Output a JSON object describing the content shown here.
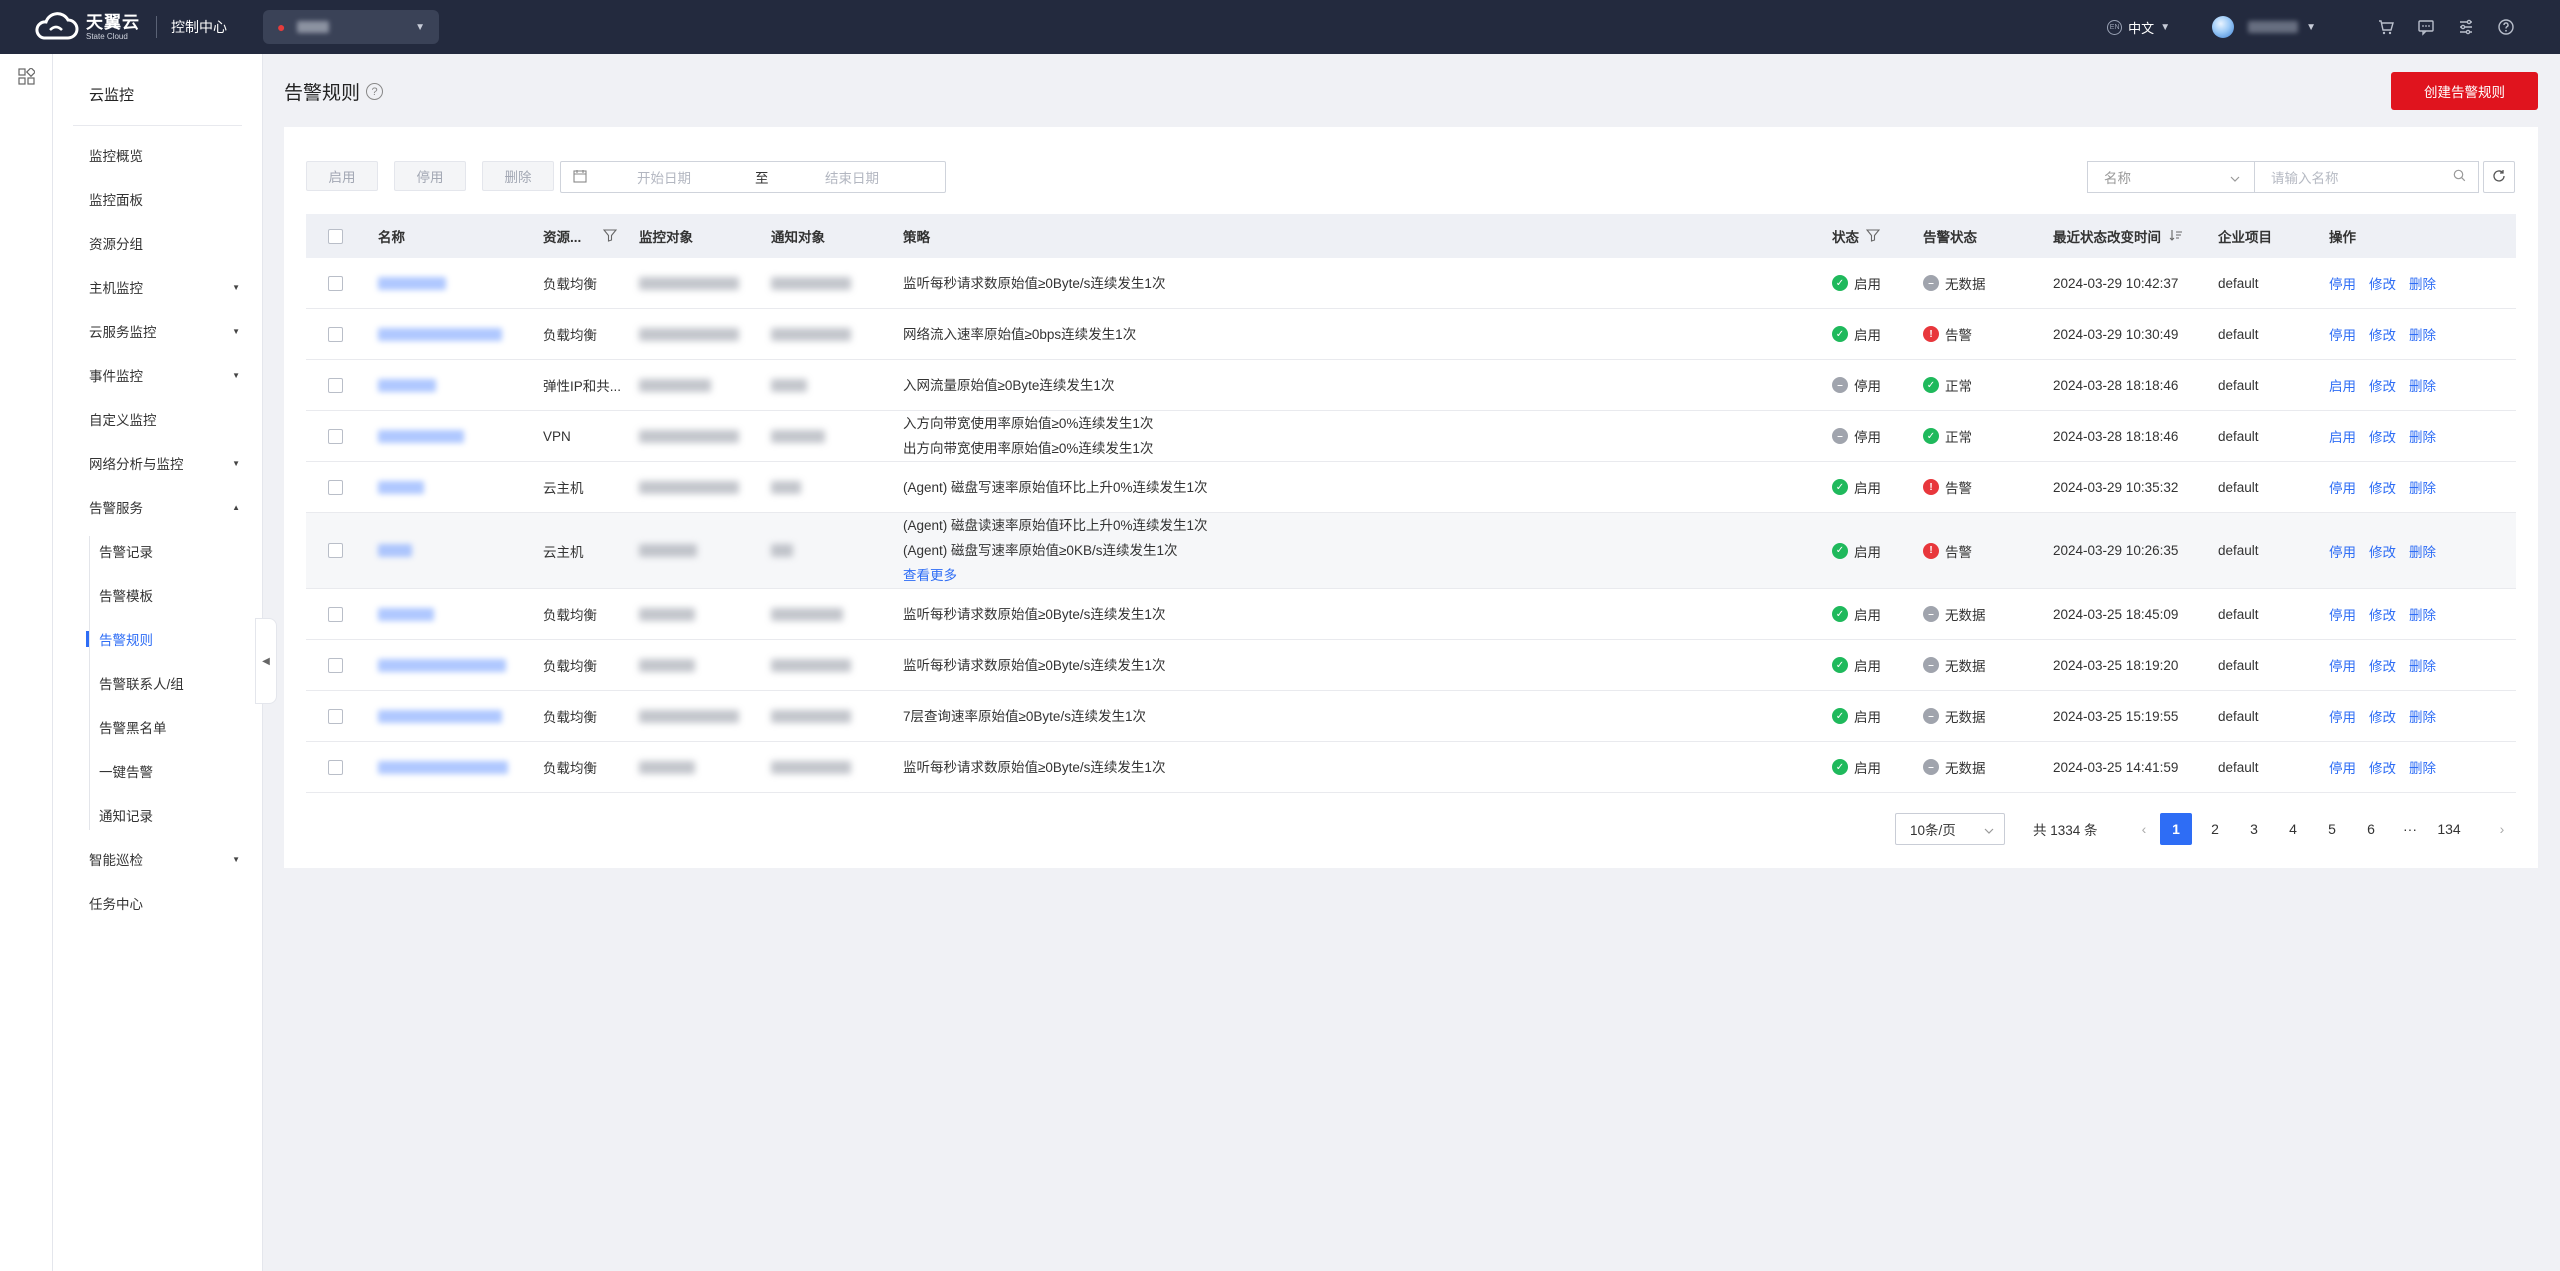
{
  "topbar": {
    "logo_cn": "天翼云",
    "logo_en": "State Cloud",
    "console": "控制中心",
    "lang": "中文",
    "lang_icon": "globe-icon",
    "icons": [
      "cart-icon",
      "message-icon",
      "settings-icon",
      "help-icon"
    ]
  },
  "sidebar": {
    "title": "云监控",
    "items": [
      {
        "label": "监控概览",
        "expandable": false
      },
      {
        "label": "监控面板",
        "expandable": false
      },
      {
        "label": "资源分组",
        "expandable": false
      },
      {
        "label": "主机监控",
        "expandable": true
      },
      {
        "label": "云服务监控",
        "expandable": true
      },
      {
        "label": "事件监控",
        "expandable": true
      },
      {
        "label": "自定义监控",
        "expandable": false
      },
      {
        "label": "网络分析与监控",
        "expandable": true
      },
      {
        "label": "告警服务",
        "expandable": true,
        "expanded": true
      },
      {
        "label": "告警记录",
        "sub": true
      },
      {
        "label": "告警模板",
        "sub": true
      },
      {
        "label": "告警规则",
        "sub": true,
        "active": true
      },
      {
        "label": "告警联系人/组",
        "sub": true
      },
      {
        "label": "告警黑名单",
        "sub": true
      },
      {
        "label": "一键告警",
        "sub": true
      },
      {
        "label": "通知记录",
        "sub": true
      },
      {
        "label": "智能巡检",
        "expandable": true
      },
      {
        "label": "任务中心",
        "expandable": false
      }
    ]
  },
  "page": {
    "title": "告警规则",
    "create_button": "创建告警规则"
  },
  "toolbar": {
    "enable": "启用",
    "disable": "停用",
    "delete": "删除",
    "start_placeholder": "开始日期",
    "to": "至",
    "end_placeholder": "结束日期",
    "filter_select": "名称",
    "search_placeholder": "请输入名称"
  },
  "table": {
    "columns": {
      "name": "名称",
      "resource": "资源...",
      "target": "监控对象",
      "notify": "通知对象",
      "policy": "策略",
      "status": "状态",
      "alarm_status": "告警状态",
      "last_change": "最近状态改变时间",
      "project": "企业项目",
      "ops": "操作"
    },
    "rows": [
      {
        "resource": "负载均衡",
        "policy": [
          "监听每秒请求数原始值≥0Byte/s连续发生1次"
        ],
        "status": "启用",
        "alarm": "无数据",
        "time": "2024-03-29 10:42:37",
        "project": "default",
        "ops": [
          "停用",
          "修改",
          "删除"
        ]
      },
      {
        "resource": "负载均衡",
        "policy": [
          "网络流入速率原始值≥0bps连续发生1次"
        ],
        "status": "启用",
        "alarm": "告警",
        "time": "2024-03-29 10:30:49",
        "project": "default",
        "ops": [
          "停用",
          "修改",
          "删除"
        ]
      },
      {
        "resource": "弹性IP和共...",
        "policy": [
          "入网流量原始值≥0Byte连续发生1次"
        ],
        "status": "停用",
        "alarm": "正常",
        "time": "2024-03-28 18:18:46",
        "project": "default",
        "ops": [
          "启用",
          "修改",
          "删除"
        ]
      },
      {
        "resource": "VPN",
        "policy": [
          "入方向带宽使用率原始值≥0%连续发生1次",
          "出方向带宽使用率原始值≥0%连续发生1次"
        ],
        "status": "停用",
        "alarm": "正常",
        "time": "2024-03-28 18:18:46",
        "project": "default",
        "ops": [
          "启用",
          "修改",
          "删除"
        ]
      },
      {
        "resource": "云主机",
        "policy": [
          "(Agent) 磁盘写速率原始值环比上升0%连续发生1次"
        ],
        "status": "启用",
        "alarm": "告警",
        "time": "2024-03-29 10:35:32",
        "project": "default",
        "ops": [
          "停用",
          "修改",
          "删除"
        ]
      },
      {
        "resource": "云主机",
        "policy": [
          "(Agent) 磁盘读速率原始值环比上升0%连续发生1次",
          "(Agent) 磁盘写速率原始值≥0KB/s连续发生1次"
        ],
        "more": "查看更多",
        "status": "启用",
        "alarm": "告警",
        "time": "2024-03-29 10:26:35",
        "project": "default",
        "ops": [
          "停用",
          "修改",
          "删除"
        ]
      },
      {
        "resource": "负载均衡",
        "policy": [
          "监听每秒请求数原始值≥0Byte/s连续发生1次"
        ],
        "status": "启用",
        "alarm": "无数据",
        "time": "2024-03-25 18:45:09",
        "project": "default",
        "ops": [
          "停用",
          "修改",
          "删除"
        ]
      },
      {
        "resource": "负载均衡",
        "policy": [
          "监听每秒请求数原始值≥0Byte/s连续发生1次"
        ],
        "status": "启用",
        "alarm": "无数据",
        "time": "2024-03-25 18:19:20",
        "project": "default",
        "ops": [
          "停用",
          "修改",
          "删除"
        ]
      },
      {
        "resource": "负载均衡",
        "policy": [
          "7层查询速率原始值≥0Byte/s连续发生1次"
        ],
        "status": "启用",
        "alarm": "无数据",
        "time": "2024-03-25 15:19:55",
        "project": "default",
        "ops": [
          "停用",
          "修改",
          "删除"
        ]
      },
      {
        "resource": "负载均衡",
        "policy": [
          "监听每秒请求数原始值≥0Byte/s连续发生1次"
        ],
        "status": "启用",
        "alarm": "无数据",
        "time": "2024-03-25 14:41:59",
        "project": "default",
        "ops": [
          "停用",
          "修改",
          "删除"
        ]
      }
    ]
  },
  "pagination": {
    "page_size": "10条/页",
    "total": "共 1334 条",
    "pages": [
      "1",
      "2",
      "3",
      "4",
      "5",
      "6",
      "···",
      "134"
    ],
    "current": "1"
  },
  "colors": {
    "topbar": "#232a3e",
    "primary": "#2e6df5",
    "danger": "#e0141e",
    "ok": "#1fb95c",
    "alarm": "#e8373c",
    "nodata": "#a0a4ad"
  }
}
